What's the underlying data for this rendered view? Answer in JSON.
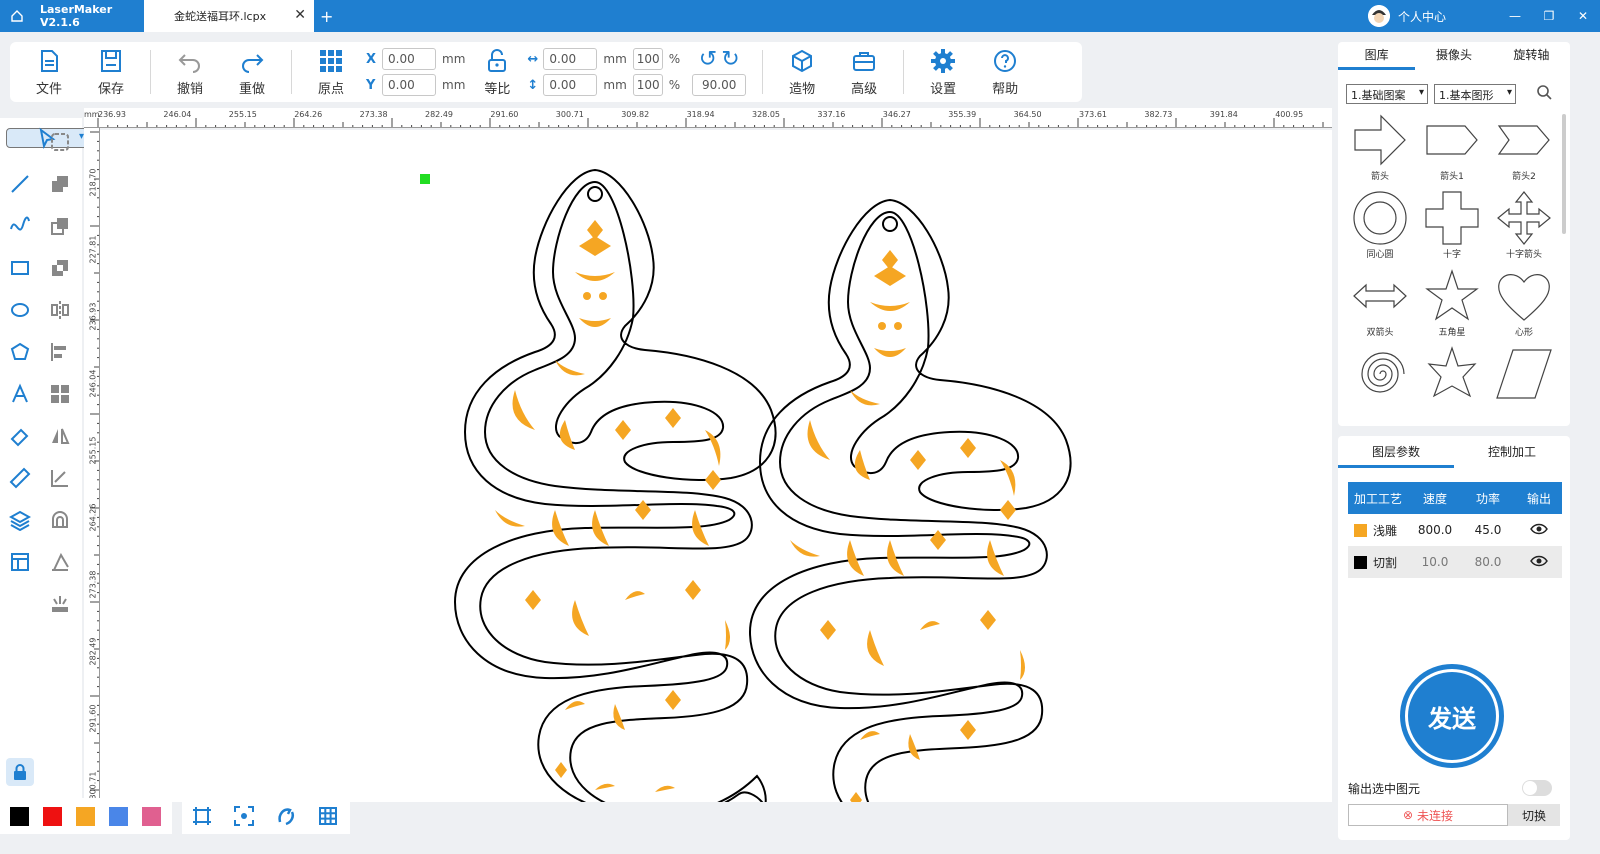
{
  "app": {
    "title": "LaserMaker V2.1.6",
    "file_tab": "金蛇送福耳环.lcpx",
    "user": "个人中心"
  },
  "toolbar": {
    "file": "文件",
    "save": "保存",
    "undo": "撤销",
    "redo": "重做",
    "origin": "原点",
    "x_label": "X",
    "y_label": "Y",
    "x_value": "0.00",
    "y_value": "0.00",
    "unit": "mm",
    "lock": "等比",
    "w_value": "0.00",
    "h_value": "0.00",
    "w_pct": "100",
    "h_pct": "100",
    "pct": "%",
    "rotation": "90.00",
    "build": "造物",
    "advanced": "高级",
    "settings": "设置",
    "help": "帮助"
  },
  "ruler": {
    "unit": "mm",
    "top": [
      "236.93",
      "246.04",
      "255.15",
      "264.26",
      "273.38",
      "282.49",
      "291.60",
      "300.71",
      "309.82",
      "318.94",
      "328.05",
      "337.16",
      "346.27",
      "355.39",
      "364.50",
      "373.61",
      "382.73",
      "391.84",
      "400.95"
    ],
    "left": [
      "218.70",
      "227.81",
      "236.93",
      "246.04",
      "255.15",
      "264.26",
      "273.38",
      "282.49",
      "291.60",
      "300.71"
    ]
  },
  "library": {
    "tabs": [
      "图库",
      "摄像头",
      "旋转轴"
    ],
    "category": "1.基础图案",
    "subcategory": "1.基本图形",
    "shapes": [
      "箭头",
      "箭头1",
      "箭头2",
      "同心圆",
      "十字",
      "十字箭头",
      "双箭头",
      "五角星",
      "心形"
    ]
  },
  "layers": {
    "tabs": [
      "图层参数",
      "控制加工"
    ],
    "headers": [
      "加工工艺",
      "速度",
      "功率",
      "输出"
    ],
    "rows": [
      {
        "name": "浅雕",
        "speed": "800.0",
        "power": "45.0",
        "color": "#f5a623"
      },
      {
        "name": "切割",
        "speed": "10.0",
        "power": "80.0",
        "color": "#000000"
      }
    ],
    "send": "发送",
    "output_selected": "输出选中图元",
    "status": "未连接",
    "switch": "切换"
  },
  "palette": [
    "#000000",
    "#ee1111",
    "#f5a623",
    "#4a86e8",
    "#e06090"
  ],
  "colors": {
    "accent": "#1f7fd0",
    "engrave": "#f5a623"
  }
}
